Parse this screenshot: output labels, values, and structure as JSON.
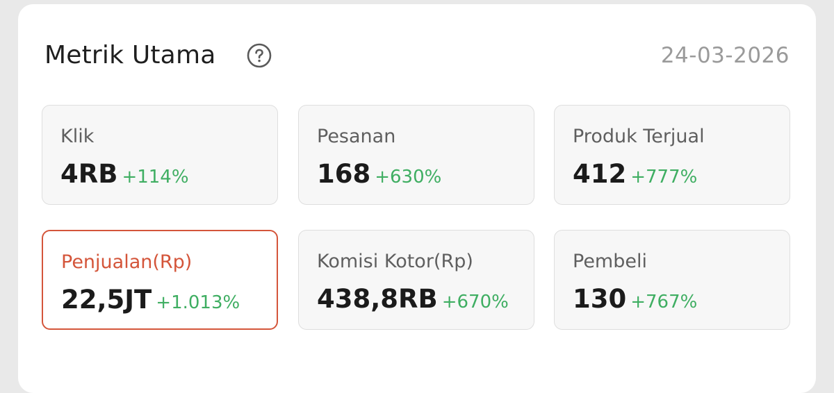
{
  "header": {
    "title": "Metrik Utama",
    "help_icon": "question-circle-icon",
    "date": "24-03-2026"
  },
  "colors": {
    "accent": "#d4553a",
    "positive": "#3fae62",
    "text_muted": "#9a9a9a"
  },
  "metrics": [
    {
      "label": "Klik",
      "value": "4RB",
      "change": "+114%",
      "selected": false
    },
    {
      "label": "Pesanan",
      "value": "168",
      "change": "+630%",
      "selected": false
    },
    {
      "label": "Produk Terjual",
      "value": "412",
      "change": "+777%",
      "selected": false
    },
    {
      "label": "Penjualan(Rp)",
      "value": "22,5JT",
      "change": "+1.013%",
      "selected": true
    },
    {
      "label": "Komisi Kotor(Rp)",
      "value": "438,8RB",
      "change": "+670%",
      "selected": false
    },
    {
      "label": "Pembeli",
      "value": "130",
      "change": "+767%",
      "selected": false
    }
  ]
}
